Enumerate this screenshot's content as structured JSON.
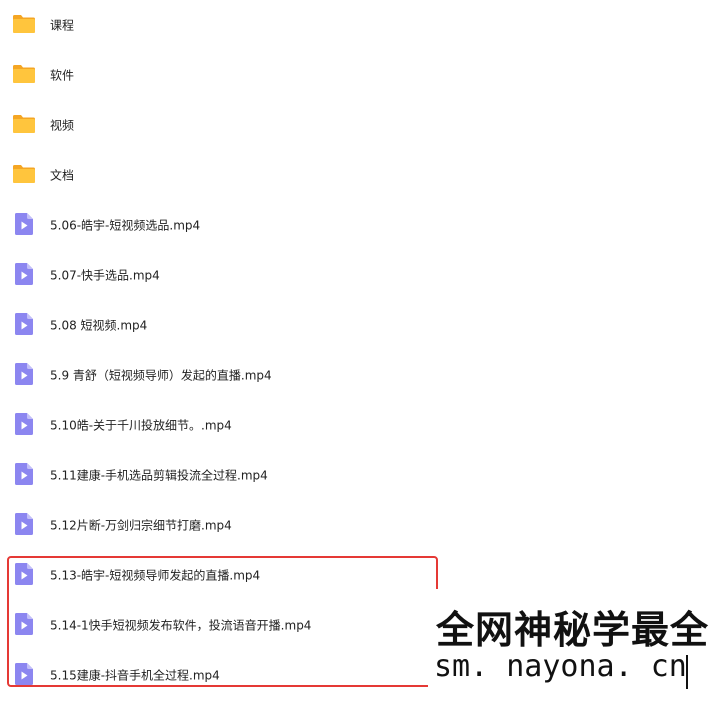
{
  "files": [
    {
      "name": "课程",
      "icon": "folder-icon"
    },
    {
      "name": "软件",
      "icon": "folder-icon"
    },
    {
      "name": "视频",
      "icon": "folder-icon"
    },
    {
      "name": "文档",
      "icon": "folder-icon"
    },
    {
      "name": "5.06-皓宇-短视频选品.mp4",
      "icon": "video-file-icon"
    },
    {
      "name": "5.07-快手选品.mp4",
      "icon": "video-file-icon"
    },
    {
      "name": "5.08 短视频.mp4",
      "icon": "video-file-icon"
    },
    {
      "name": "5.9 青舒（短视频导师）发起的直播.mp4",
      "icon": "video-file-icon"
    },
    {
      "name": "5.10皓-关于千川投放细节。.mp4",
      "icon": "video-file-icon"
    },
    {
      "name": "5.11建康-手机选品剪辑投流全过程.mp4",
      "icon": "video-file-icon"
    },
    {
      "name": "5.12片断-万剑归宗细节打磨.mp4",
      "icon": "video-file-icon"
    },
    {
      "name": "5.13-皓宇-短视频导师发起的直播.mp4",
      "icon": "video-file-icon"
    },
    {
      "name": "5.14-1快手短视频发布软件，投流语音开播.mp4",
      "icon": "video-file-icon"
    },
    {
      "name": "5.15建康-抖音手机全过程.mp4",
      "icon": "video-file-icon"
    }
  ],
  "watermark": {
    "line1": "全网神秘学最全",
    "line2": "sm. nayona. cn"
  },
  "colors": {
    "folder": "#FFC53D",
    "folder_tab": "#F5A623",
    "video_icon": "#8C86F0",
    "highlight_border": "#E53935"
  }
}
